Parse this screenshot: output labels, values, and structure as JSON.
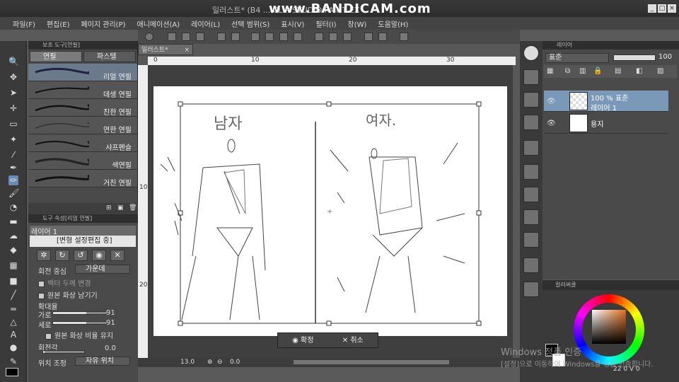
{
  "window": {
    "title": "일러스트* (B4 ... CLIP STUDIO PAINT EX",
    "watermark": "www.BANDICAM.com"
  },
  "menu": [
    "파일(F)",
    "편집(E)",
    "페이지 관리(P)",
    "애니메이션(A)",
    "레이어(L)",
    "선택 범위(S)",
    "표시(V)",
    "필터(I)",
    "창(W)",
    "도움말(H)"
  ],
  "subtool": {
    "header": "보조 도구[연필]",
    "tabs": [
      "연필",
      "파스텔"
    ],
    "brushes": [
      "리얼 연필",
      "데생 연필",
      "진한 연필",
      "연한 연필",
      "샤프펜슬",
      "색연필",
      "거친 연필"
    ]
  },
  "toolprop": {
    "header": "도구 속성[리얼 연필]",
    "layer_name": "레이어 1",
    "edit_state": "[변형 설정편집 중]",
    "rotation_center_label": "회전 중심",
    "rotation_center_value": "가운데",
    "vector_width_label": "벡터 두께 변경",
    "keep_original_label": "원본 화상 남기기",
    "scale_label": "확대율",
    "width_label": "가로",
    "width_value": "91",
    "width_fraction": 0.62,
    "height_label": "세로",
    "height_value": "91",
    "height_fraction": 0.62,
    "keep_ratio_label": "원본 화상 비율 유지",
    "rotation_angle_label": "회전각",
    "rotation_angle_value": "0.0",
    "position_label": "위치 조정",
    "position_value": "자유 위치"
  },
  "canvas": {
    "doc_tab": "일러스트*",
    "ruler_ticks": [
      "0",
      "10",
      "20",
      "30"
    ],
    "ruler_v_ticks": [
      "10",
      "20"
    ],
    "confirm": "확정",
    "cancel": "취소",
    "zoom": "13.0",
    "angle": "0.0"
  },
  "layers": {
    "header": "레이어",
    "blend_mode": "표준",
    "opacity": "100",
    "rows": [
      {
        "line1": "100 % 표준",
        "line2": "레이어 1",
        "selected": true
      },
      {
        "line1": "",
        "line2": "용지",
        "selected": false
      }
    ]
  },
  "color": {
    "header": "컬러써클",
    "readout": "22 0 V 0"
  },
  "windows_wm": {
    "line1": "Windows 정품 인증",
    "line2": "[설정]으로 이동하여 Windows를 정품 인증합니다."
  },
  "sketch": {
    "left_text": "남자",
    "right_text": "여자."
  }
}
